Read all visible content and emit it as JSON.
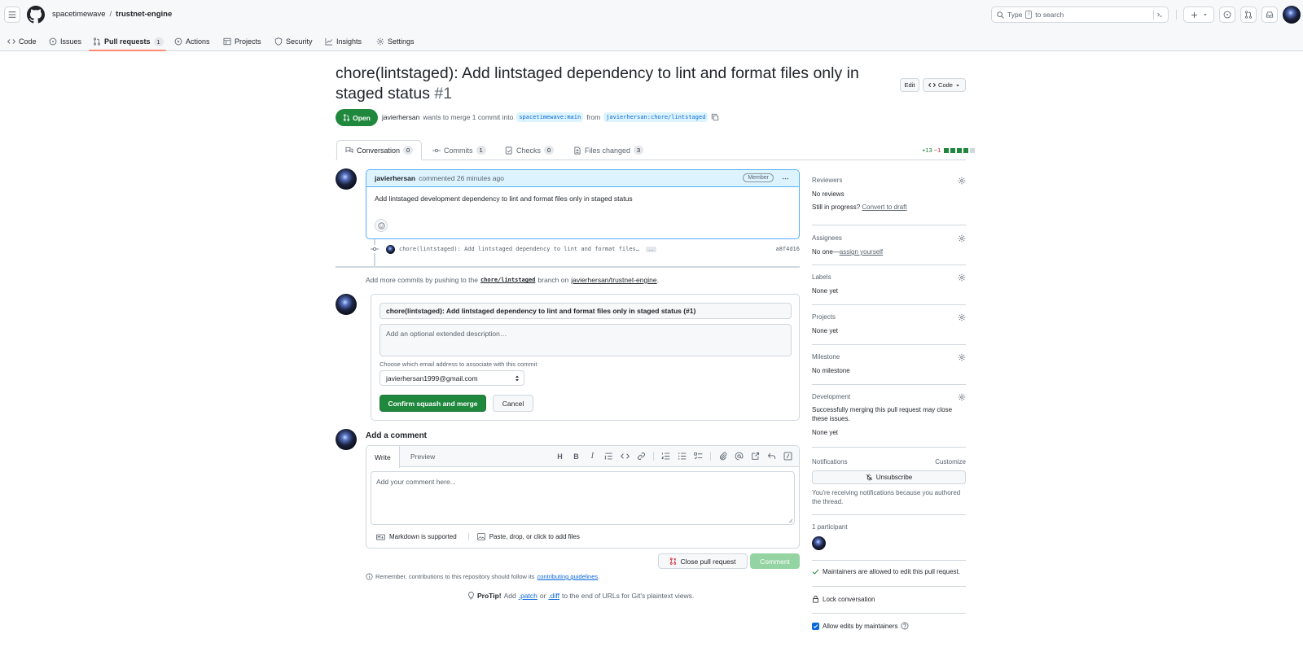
{
  "header": {
    "owner": "spacetimewave",
    "separator": "/",
    "repo": "trustnet-engine",
    "search_pre": "Type",
    "search_key": "/",
    "search_post": "to search"
  },
  "repo_nav": [
    {
      "label": "Code"
    },
    {
      "label": "Issues"
    },
    {
      "label": "Pull requests",
      "count": "1"
    },
    {
      "label": "Actions"
    },
    {
      "label": "Projects"
    },
    {
      "label": "Security"
    },
    {
      "label": "Insights"
    },
    {
      "label": "Settings"
    }
  ],
  "pr": {
    "title": "chore(lintstaged): Add lintstaged dependency to lint and format files only in staged status",
    "number": "#1",
    "edit_label": "Edit",
    "code_label": "Code",
    "state": "Open",
    "author": "javierhersan",
    "merge_text": "wants to merge 1 commit into",
    "base_branch": "spacetimewave:main",
    "from_text": "from",
    "head_branch": "javierhersan:chore/lintstaged"
  },
  "tabs": [
    {
      "label": "Conversation",
      "count": "0"
    },
    {
      "label": "Commits",
      "count": "1"
    },
    {
      "label": "Checks",
      "count": "0"
    },
    {
      "label": "Files changed",
      "count": "3"
    }
  ],
  "diffstat": {
    "additions": "+13",
    "deletions": "−1"
  },
  "comment": {
    "author": "javierhersan",
    "action": "commented 26 minutes ago",
    "badge": "Member",
    "body": "Add lintstaged development dependency to lint and format files only in staged status"
  },
  "commit": {
    "message": "chore(lintstaged): Add lintstaged dependency to lint and format files…",
    "ellipsis": "…",
    "sha": "a8f4d16"
  },
  "push_note": {
    "pre": "Add more commits by pushing to the",
    "branch": "chore/lintstaged",
    "mid": "branch on",
    "repo": "javierhersan/trustnet-engine",
    "post": "."
  },
  "merge": {
    "commit_title": "chore(lintstaged): Add lintstaged dependency to lint and format files only in staged status (#1)",
    "description_placeholder": "Add an optional extended description…",
    "email_label": "Choose which email address to associate with this commit",
    "email": "javierhersan1999@gmail.com",
    "confirm_label": "Confirm squash and merge",
    "cancel_label": "Cancel"
  },
  "add_comment": {
    "title": "Add a comment",
    "write_tab": "Write",
    "preview_tab": "Preview",
    "placeholder": "Add your comment here...",
    "markdown_note": "Markdown is supported",
    "attach_note": "Paste, drop, or click to add files",
    "close_label": "Close pull request",
    "comment_label": "Comment"
  },
  "footer": {
    "remember_pre": "Remember, contributions to this repository should follow its",
    "remember_link": "contributing guidelines",
    "remember_post": ".",
    "protip_label": "ProTip!",
    "protip_pre": "Add",
    "patch": ".patch",
    "or": "or",
    "diff": ".diff",
    "protip_post": "to the end of URLs for Git's plaintext views."
  },
  "sidebar": {
    "reviewers_title": "Reviewers",
    "reviewers_value": "No reviews",
    "still_progress": "Still in progress?",
    "convert_draft": "Convert to draft",
    "assignees_title": "Assignees",
    "assignees_value": "No one—",
    "assign_yourself": "assign yourself",
    "labels_title": "Labels",
    "labels_value": "None yet",
    "projects_title": "Projects",
    "projects_value": "None yet",
    "milestone_title": "Milestone",
    "milestone_value": "No milestone",
    "development_title": "Development",
    "development_text": "Successfully merging this pull request may close these issues.",
    "development_value": "None yet",
    "notifications_title": "Notifications",
    "customize": "Customize",
    "unsubscribe": "Unsubscribe",
    "notif_reason": "You're receiving notifications because you authored the thread.",
    "participants": "1 participant",
    "maintainers_allowed": "Maintainers are allowed to edit this pull request.",
    "lock": "Lock conversation",
    "allow_edits": "Allow edits by maintainers"
  },
  "icons": [
    "menu-icon",
    "github-logo-icon",
    "search-icon",
    "command-palette-icon",
    "plus-icon",
    "issues-icon",
    "pull-request-icon",
    "inbox-icon",
    "gear-icon",
    "smiley-icon",
    "copy-icon",
    "kebab-icon",
    "bell-slash-icon",
    "check-icon",
    "lock-icon",
    "info-icon",
    "lightbulb-icon",
    "question-icon"
  ],
  "colors": {
    "accent": "#0969da",
    "success": "#1f883d",
    "danger": "#d1242f",
    "border": "#d0d7de"
  }
}
